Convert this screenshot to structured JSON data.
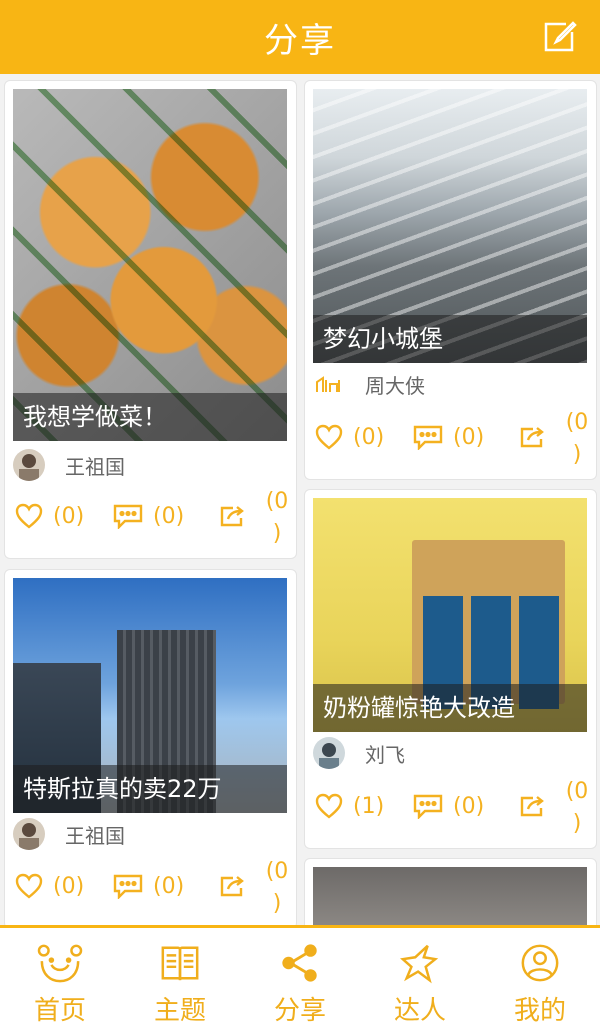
{
  "header": {
    "title": "分享",
    "compose_icon": "compose-icon"
  },
  "colors": {
    "accent": "#f8b514",
    "icon": "#f4b120"
  },
  "posts": [
    {
      "title": "我想学做菜！",
      "author": "王祖国",
      "likes": "(0)",
      "comments": "(0)",
      "shares": [
        "(0",
        ")"
      ]
    },
    {
      "title": "梦幻小城堡",
      "author": "周大侠",
      "likes": "(0)",
      "comments": "(0)",
      "shares": [
        "(0",
        ")"
      ]
    },
    {
      "title": "特斯拉真的卖22万",
      "author": "王祖国",
      "likes": "(0)",
      "comments": "(0)",
      "shares": [
        "(0",
        ")"
      ]
    },
    {
      "title": "奶粉罐惊艳大改造",
      "author": "刘飞",
      "likes": "(1)",
      "comments": "(0)",
      "shares": [
        "(0",
        ")"
      ]
    }
  ],
  "tabs": [
    {
      "label": "首页",
      "icon": "home-face-icon"
    },
    {
      "label": "主题",
      "icon": "book-icon"
    },
    {
      "label": "分享",
      "icon": "share-icon"
    },
    {
      "label": "达人",
      "icon": "star-icon"
    },
    {
      "label": "我的",
      "icon": "profile-icon"
    }
  ]
}
